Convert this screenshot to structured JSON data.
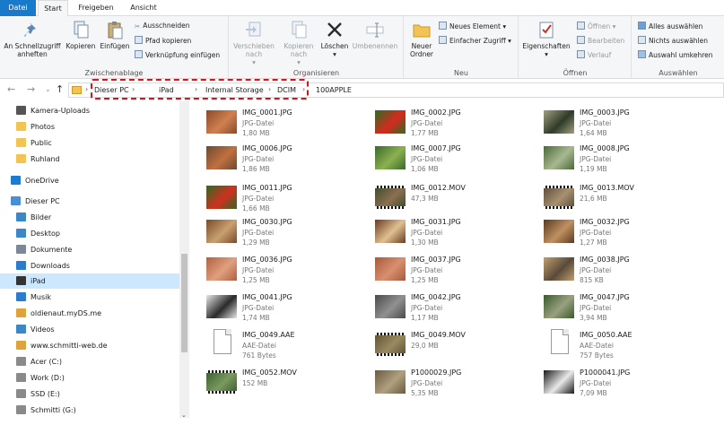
{
  "tabs": [
    "Datei",
    "Start",
    "Freigeben",
    "Ansicht"
  ],
  "ribbon": {
    "clipboard": {
      "label": "Zwischenablage",
      "pin_label": "An Schnellzugriff anheften",
      "copy_label": "Kopieren",
      "paste_label": "Einfügen",
      "cut_label": "Ausschneiden",
      "copy_path_label": "Pfad kopieren",
      "paste_shortcut_label": "Verknüpfung einfügen"
    },
    "organize": {
      "label": "Organisieren",
      "move_label": "Verschieben nach",
      "copyto_label": "Kopieren nach",
      "delete_label": "Löschen",
      "rename_label": "Umbenennen"
    },
    "new": {
      "label": "Neu",
      "new_folder_label": "Neuer Ordner",
      "new_item_label": "Neues Element",
      "easy_access_label": "Einfacher Zugriff"
    },
    "open": {
      "label": "Öffnen",
      "properties_label": "Eigenschaften",
      "open_label": "Öffnen",
      "edit_label": "Bearbeiten",
      "history_label": "Verlauf"
    },
    "select": {
      "label": "Auswählen",
      "select_all_label": "Alles auswählen",
      "select_none_label": "Nichts auswählen",
      "invert_label": "Auswahl umkehren"
    }
  },
  "address": {
    "crumbs": [
      "Dieser PC",
      "iPad",
      "Internal Storage",
      "DCIM",
      "100APPLE"
    ]
  },
  "sidebar": {
    "items": [
      {
        "label": "Kamera-Uploads",
        "icon": "camera-folder-icon",
        "color": "#555555"
      },
      {
        "label": "Photos",
        "icon": "folder-icon",
        "color": "#f3c454"
      },
      {
        "label": "Public",
        "icon": "folder-icon",
        "color": "#f3c454"
      },
      {
        "label": "Ruhland",
        "icon": "folder-icon",
        "color": "#f3c454"
      },
      {
        "label": "OneDrive",
        "icon": "onedrive-icon",
        "color": "#1f7ad1"
      },
      {
        "label": "Dieser PC",
        "icon": "computer-icon",
        "color": "#4a8fd6"
      },
      {
        "label": "Bilder",
        "icon": "pictures-icon",
        "color": "#3d86c8"
      },
      {
        "label": "Desktop",
        "icon": "desktop-icon",
        "color": "#3d86c8"
      },
      {
        "label": "Dokumente",
        "icon": "documents-icon",
        "color": "#7b8898"
      },
      {
        "label": "Downloads",
        "icon": "downloads-icon",
        "color": "#2b7bd0"
      },
      {
        "label": "iPad",
        "icon": "ipad-icon",
        "color": "#333333"
      },
      {
        "label": "Musik",
        "icon": "music-icon",
        "color": "#2b7bd0"
      },
      {
        "label": "oldienaut.myDS.me",
        "icon": "network-drive-icon",
        "color": "#e0a23a"
      },
      {
        "label": "Videos",
        "icon": "videos-icon",
        "color": "#3d86c8"
      },
      {
        "label": "www.schmitti-web.de",
        "icon": "network-drive-icon",
        "color": "#e0a23a"
      },
      {
        "label": "Acer (C:)",
        "icon": "drive-icon",
        "color": "#8a8a8a"
      },
      {
        "label": "Work (D:)",
        "icon": "drive-icon",
        "color": "#8a8a8a"
      },
      {
        "label": "SSD (E:)",
        "icon": "drive-icon",
        "color": "#8a8a8a"
      },
      {
        "label": "Schmitti (G:)",
        "icon": "drive-icon",
        "color": "#8a8a8a"
      }
    ]
  },
  "files": [
    {
      "name": "IMG_0001.JPG",
      "type": "JPG-Datei",
      "size": "1,80 MB",
      "kind": "photo",
      "c1": "#8a4a2a",
      "c2": "#d08050"
    },
    {
      "name": "IMG_0002.JPG",
      "type": "JPG-Datei",
      "size": "1,77 MB",
      "kind": "photo",
      "c1": "#2e6b22",
      "c2": "#d62a1e"
    },
    {
      "name": "IMG_0003.JPG",
      "type": "JPG-Datei",
      "size": "1,64 MB",
      "kind": "photo",
      "c1": "#a0a080",
      "c2": "#2f3a2a"
    },
    {
      "name": "IMG_0006.JPG",
      "type": "JPG-Datei",
      "size": "1,86 MB",
      "kind": "photo",
      "c1": "#6b4a30",
      "c2": "#c07040"
    },
    {
      "name": "IMG_0007.JPG",
      "type": "JPG-Datei",
      "size": "1,06 MB",
      "kind": "photo",
      "c1": "#3a6a2a",
      "c2": "#8cb050"
    },
    {
      "name": "IMG_0008.JPG",
      "type": "JPG-Datei",
      "size": "1,19 MB",
      "kind": "photo",
      "c1": "#4a6a38",
      "c2": "#a8b890"
    },
    {
      "name": "IMG_0011.JPG",
      "type": "JPG-Datei",
      "size": "1,66 MB",
      "kind": "photo",
      "c1": "#2f6a22",
      "c2": "#d03020"
    },
    {
      "name": "IMG_0012.MOV",
      "type": "",
      "size": "47,3 MB",
      "kind": "video",
      "c1": "#3a4a2a",
      "c2": "#8a7050"
    },
    {
      "name": "IMG_0013.MOV",
      "type": "",
      "size": "21,6 MB",
      "kind": "video",
      "c1": "#5a4a3a",
      "c2": "#a89070"
    },
    {
      "name": "IMG_0030.JPG",
      "type": "JPG-Datei",
      "size": "1,29 MB",
      "kind": "photo",
      "c1": "#7a4a2a",
      "c2": "#c8a070"
    },
    {
      "name": "IMG_0031.JPG",
      "type": "JPG-Datei",
      "size": "1,30 MB",
      "kind": "photo",
      "c1": "#6a3a22",
      "c2": "#e0c090"
    },
    {
      "name": "IMG_0032.JPG",
      "type": "JPG-Datei",
      "size": "1,27 MB",
      "kind": "photo",
      "c1": "#5a3a22",
      "c2": "#c09060"
    },
    {
      "name": "IMG_0036.JPG",
      "type": "JPG-Datei",
      "size": "1,25 MB",
      "kind": "photo",
      "c1": "#b06040",
      "c2": "#e0a080"
    },
    {
      "name": "IMG_0037.JPG",
      "type": "JPG-Datei",
      "size": "1,25 MB",
      "kind": "photo",
      "c1": "#a85a3a",
      "c2": "#d89070"
    },
    {
      "name": "IMG_0038.JPG",
      "type": "JPG-Datei",
      "size": "815 KB",
      "kind": "photo",
      "c1": "#c0a070",
      "c2": "#5a4a3a"
    },
    {
      "name": "IMG_0041.JPG",
      "type": "JPG-Datei",
      "size": "1,74 MB",
      "kind": "photo",
      "c1": "#e8e8e8",
      "c2": "#2a2a2a"
    },
    {
      "name": "IMG_0042.JPG",
      "type": "JPG-Datei",
      "size": "1,17 MB",
      "kind": "photo",
      "c1": "#4a4a4a",
      "c2": "#909090"
    },
    {
      "name": "IMG_0047.JPG",
      "type": "JPG-Datei",
      "size": "3,94 MB",
      "kind": "photo",
      "c1": "#3a5a2a",
      "c2": "#9aa080"
    },
    {
      "name": "IMG_0049.AAE",
      "type": "AAE-Datei",
      "size": "761 Bytes",
      "kind": "doc",
      "c1": "#ffffff",
      "c2": "#cccccc"
    },
    {
      "name": "IMG_0049.MOV",
      "type": "",
      "size": "29,0 MB",
      "kind": "video",
      "c1": "#5a5030",
      "c2": "#9a8a60"
    },
    {
      "name": "IMG_0050.AAE",
      "type": "AAE-Datei",
      "size": "757 Bytes",
      "kind": "doc",
      "c1": "#ffffff",
      "c2": "#cccccc"
    },
    {
      "name": "IMG_0052.MOV",
      "type": "",
      "size": "152 MB",
      "kind": "video",
      "c1": "#3a5a30",
      "c2": "#7a9a60"
    },
    {
      "name": "P1000029.JPG",
      "type": "JPG-Datei",
      "size": "5,35 MB",
      "kind": "photo",
      "c1": "#6a5a40",
      "c2": "#b0a080"
    },
    {
      "name": "P1000041.JPG",
      "type": "JPG-Datei",
      "size": "7,09 MB",
      "kind": "photo",
      "c1": "#1a1a1a",
      "c2": "#e8e8e8"
    }
  ]
}
